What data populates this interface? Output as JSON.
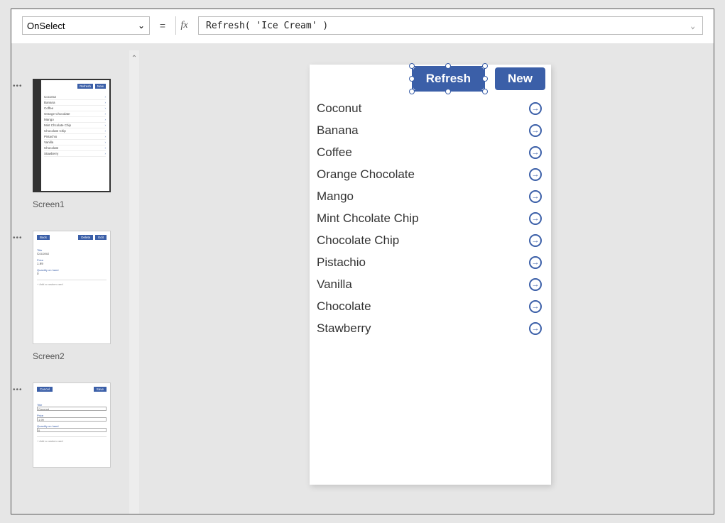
{
  "formula_bar": {
    "property": "OnSelect",
    "equals": "=",
    "fx": "fx",
    "expression": "Refresh( 'Ice Cream' )"
  },
  "thumbnails": {
    "screen1": {
      "label": "Screen1",
      "refresh": "Refresh",
      "new": "New",
      "items": [
        "Coconut",
        "Banana",
        "Coffee",
        "Orange Chocolate",
        "Mango",
        "Mint Chcolate Chip",
        "Chocolate Chip",
        "Pistachio",
        "Vanilla",
        "Chocolate",
        "Stawberry"
      ]
    },
    "screen2": {
      "label": "Screen2",
      "back": "Back",
      "delete": "Delete",
      "edit": "Edit",
      "title_lbl": "Title",
      "title_val": "Coconut",
      "price_lbl": "Price",
      "price_val": "1.99",
      "qty_lbl": "Quantity on hand",
      "qty_val": "0",
      "add": "+  Add a custom card"
    },
    "screen3": {
      "cancel": "Cancel",
      "save": "Save",
      "title_lbl": "Title",
      "title_val": "Coconut",
      "price_lbl": "Price",
      "price_val": "1.99",
      "qty_lbl": "Quantity on hand",
      "qty_val": "0",
      "add": "+  Add a custom card"
    }
  },
  "canvas": {
    "refresh_label": "Refresh",
    "new_label": "New",
    "items": [
      {
        "title": "Coconut"
      },
      {
        "title": "Banana"
      },
      {
        "title": "Coffee"
      },
      {
        "title": "Orange Chocolate"
      },
      {
        "title": "Mango"
      },
      {
        "title": "Mint Chcolate Chip"
      },
      {
        "title": "Chocolate Chip"
      },
      {
        "title": "Pistachio"
      },
      {
        "title": "Vanilla"
      },
      {
        "title": "Chocolate"
      },
      {
        "title": "Stawberry"
      }
    ]
  }
}
